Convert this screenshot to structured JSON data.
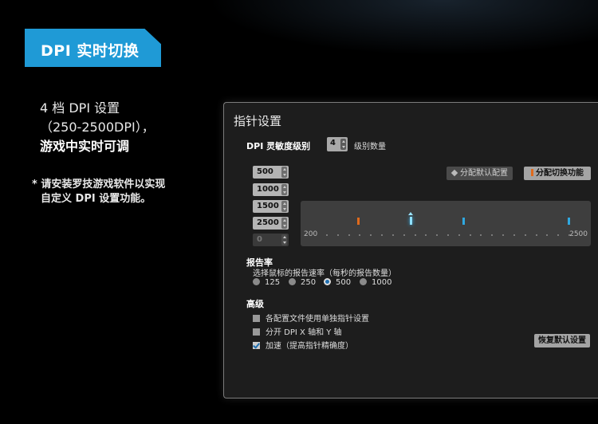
{
  "promo": {
    "banner": "DPI 实时切换",
    "feature_lines": [
      "4 档 DPI 设置",
      "（250-2500DPI），",
      "游戏中实时可调"
    ],
    "note_lines": [
      "* 请安装罗技游戏软件以实现",
      "自定义 DPI 设置功能。"
    ]
  },
  "panel": {
    "title": "指针设置",
    "sensitivity": {
      "label": "DPI 灵敏度级别",
      "levels_value": "4",
      "levels_label": "级别数量",
      "dpi_values": [
        "500",
        "1000",
        "1500",
        "2500",
        "0"
      ],
      "default_button": "分配默认配置",
      "shift_button": "分配切换功能",
      "slider_min": "200",
      "slider_max": "2500",
      "slider_range": [
        200,
        2500
      ],
      "markers": [
        {
          "dpi": 500,
          "type": "shift",
          "color": "#e06a1c"
        },
        {
          "dpi": 1000,
          "type": "default-selected",
          "color": "#8fe0ff"
        },
        {
          "dpi": 1500,
          "type": "level",
          "color": "#2fa8e0"
        },
        {
          "dpi": 2500,
          "type": "level",
          "color": "#2fa8e0"
        }
      ]
    },
    "report_rate": {
      "heading": "报告率",
      "description": "选择鼠标的报告速率（每秒的报告数量）",
      "options": [
        "125",
        "250",
        "500",
        "1000"
      ],
      "selected": "500"
    },
    "advanced": {
      "heading": "高级",
      "options": [
        {
          "label": "各配置文件使用单独指针设置",
          "checked": false
        },
        {
          "label": "分开 DPI X 轴和 Y 轴",
          "checked": false
        },
        {
          "label": "加速（提高指针精确度）",
          "checked": true
        }
      ],
      "restore_button": "恢复默认设置"
    }
  }
}
